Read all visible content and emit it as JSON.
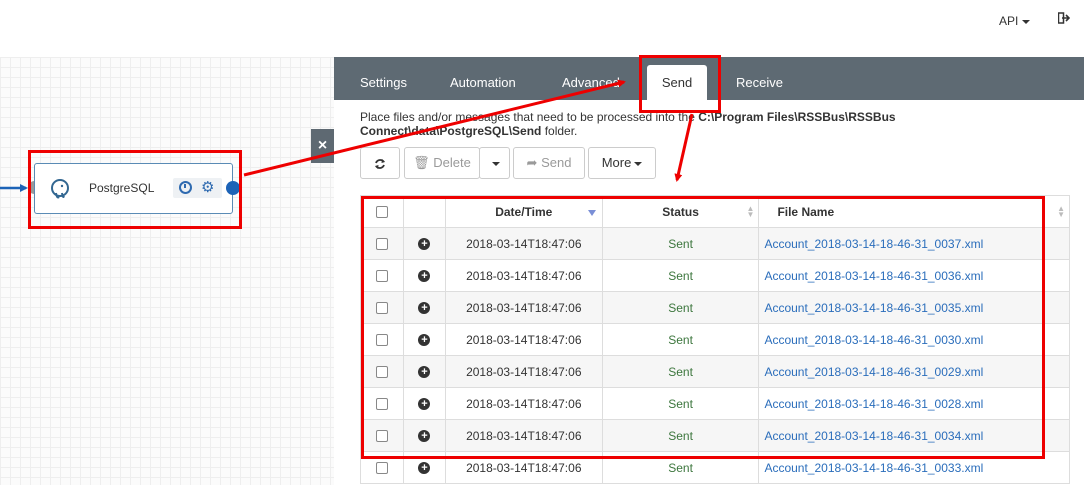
{
  "header": {
    "api_label": "API",
    "logout_icon": "sign-out-icon"
  },
  "node": {
    "label": "PostgreSQL",
    "icon": "postgresql-elephant-icon"
  },
  "tabs": [
    {
      "label": "Settings"
    },
    {
      "label": "Automation"
    },
    {
      "label": "Advanced"
    },
    {
      "label": "Send",
      "active": true
    },
    {
      "label": "Receive"
    }
  ],
  "instructions": {
    "prefix": "Place files and/or messages that need to be processed into the ",
    "path": "C:\\Program Files\\RSSBus\\RSSBus Connect\\data\\PostgreSQL\\Send",
    "suffix": " folder."
  },
  "toolbar": {
    "delete_label": "Delete",
    "send_label": "Send",
    "more_label": "More"
  },
  "table": {
    "columns": [
      "Date/Time",
      "Status",
      "File Name"
    ],
    "rows": [
      {
        "datetime": "2018-03-14T18:47:06",
        "status": "Sent",
        "filename": "Account_2018-03-14-18-46-31_0037.xml"
      },
      {
        "datetime": "2018-03-14T18:47:06",
        "status": "Sent",
        "filename": "Account_2018-03-14-18-46-31_0036.xml"
      },
      {
        "datetime": "2018-03-14T18:47:06",
        "status": "Sent",
        "filename": "Account_2018-03-14-18-46-31_0035.xml"
      },
      {
        "datetime": "2018-03-14T18:47:06",
        "status": "Sent",
        "filename": "Account_2018-03-14-18-46-31_0030.xml"
      },
      {
        "datetime": "2018-03-14T18:47:06",
        "status": "Sent",
        "filename": "Account_2018-03-14-18-46-31_0029.xml"
      },
      {
        "datetime": "2018-03-14T18:47:06",
        "status": "Sent",
        "filename": "Account_2018-03-14-18-46-31_0028.xml"
      },
      {
        "datetime": "2018-03-14T18:47:06",
        "status": "Sent",
        "filename": "Account_2018-03-14-18-46-31_0034.xml"
      },
      {
        "datetime": "2018-03-14T18:47:06",
        "status": "Sent",
        "filename": "Account_2018-03-14-18-46-31_0033.xml"
      }
    ]
  },
  "colors": {
    "tabbar": "#5e6a73",
    "accent": "#2a6dbb",
    "status_sent": "#3c763d",
    "annotation": "#e00000"
  }
}
